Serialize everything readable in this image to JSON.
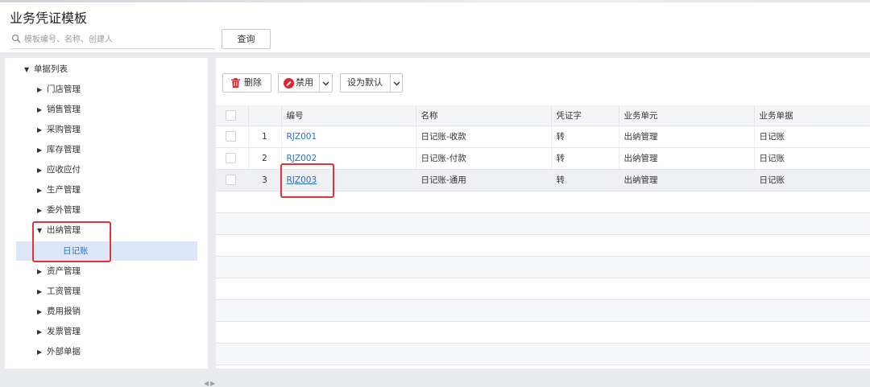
{
  "header": {
    "title": "业务凭证模板",
    "search_placeholder": "模板编号、名称、创建人",
    "search_value": "",
    "query_label": "查询"
  },
  "tree": {
    "root": "单据列表",
    "items": [
      "门店管理",
      "销售管理",
      "采购管理",
      "库存管理",
      "应收应付",
      "生产管理",
      "委外管理",
      "出纳管理",
      "资产管理",
      "工资管理",
      "费用报销",
      "发票管理",
      "外部单据"
    ],
    "expanded_item": "出纳管理",
    "selected_leaf": "日记账"
  },
  "toolbar": {
    "delete_label": "删除",
    "disable_label": "禁用",
    "set_default_label": "设为默认"
  },
  "table": {
    "columns": [
      "编号",
      "名称",
      "凭证字",
      "业务单元",
      "业务单据"
    ],
    "rows": [
      {
        "index": "1",
        "code": "RJZ001",
        "name": "日记账-收款",
        "voucher": "转",
        "unit": "出纳管理",
        "doc": "日记账"
      },
      {
        "index": "2",
        "code": "RJZ002",
        "name": "日记账-付款",
        "voucher": "转",
        "unit": "出纳管理",
        "doc": "日记账"
      },
      {
        "index": "3",
        "code": "RJZ003",
        "name": "日记账-通用",
        "voucher": "转",
        "unit": "出纳管理",
        "doc": "日记账"
      }
    ]
  },
  "colors": {
    "link": "#2c6fc5",
    "highlight_box": "#e8303a",
    "selected_bg": "#dce8f7",
    "danger": "#e2242e"
  }
}
